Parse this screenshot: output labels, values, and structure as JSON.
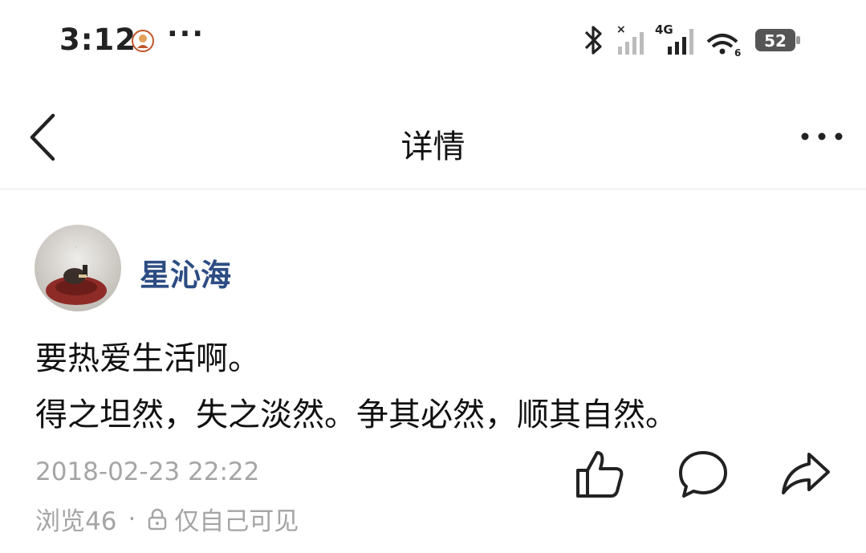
{
  "status_bar": {
    "time": "3:12",
    "dots": "···",
    "battery_level": "52",
    "network_label": "4G",
    "wifi_label": "6"
  },
  "nav": {
    "title": "详情"
  },
  "post": {
    "author": "星沁海",
    "lines": [
      "要热爱生活啊。",
      "得之坦然，失之淡然。争其必然，顺其自然。"
    ],
    "timestamp": "2018-02-23 22:22",
    "views": "浏览46",
    "separator": "·",
    "visibility": "仅自己可见"
  },
  "colors": {
    "author": "#2c4c83",
    "meta": "#a5a5a5",
    "divider": "#e8e8e8"
  },
  "icons": [
    "back-icon",
    "more-icon",
    "like-icon",
    "comment-icon",
    "share-icon",
    "lock-icon",
    "bluetooth-icon",
    "signal-icon",
    "wifi-icon",
    "battery-icon"
  ]
}
